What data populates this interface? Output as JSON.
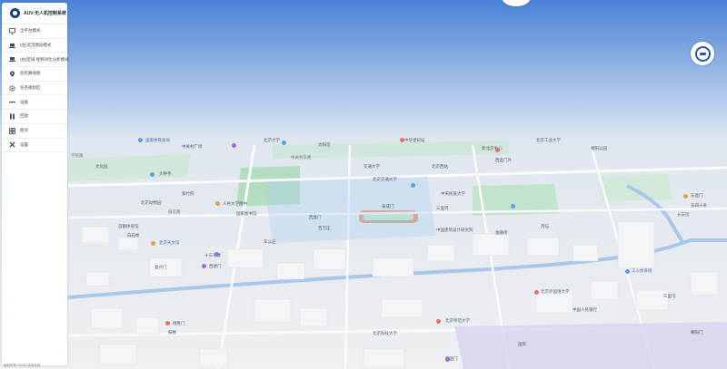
{
  "app": {
    "title": "AUV-无人机控制系统"
  },
  "menu": [
    {
      "icon": "monitor-icon",
      "label": "全平台模式"
    },
    {
      "icon": "laptop-icon",
      "label": "(左)灵活图层模式"
    },
    {
      "icon": "laptop-icon",
      "label": "(右)区域 视频对比分析模式"
    },
    {
      "icon": "location-pin-icon",
      "label": "巡检路线图"
    },
    {
      "icon": "gear-icon",
      "label": "任务规划区"
    },
    {
      "icon": "drone-icon",
      "label": "设备"
    },
    {
      "icon": "pause-icon",
      "label": "回放"
    },
    {
      "icon": "grid-icon",
      "label": "图文"
    },
    {
      "icon": "tools-icon",
      "label": "设置"
    }
  ],
  "footer": {
    "text": "版权所有 ©2023 技术支持"
  },
  "map": {
    "labels": [
      {
        "text": "国家体育总局",
        "color": "blue"
      },
      {
        "text": "中关村广场",
        "color": "gray"
      },
      {
        "text": "北京大学",
        "color": "gray"
      },
      {
        "text": "太阳宫",
        "color": "gray"
      },
      {
        "text": "中华世纪坛",
        "color": "gray"
      },
      {
        "text": "新北京中心",
        "color": "gray"
      },
      {
        "text": "北京工业大学",
        "color": "gray"
      },
      {
        "text": "朝阳公园",
        "color": "gray"
      },
      {
        "text": "学院路",
        "color": "road"
      },
      {
        "text": "文化园",
        "color": "gray"
      },
      {
        "text": "大钟寺",
        "color": "gray"
      },
      {
        "text": "中关村东路",
        "color": "road"
      },
      {
        "text": "交通大学",
        "color": "gray"
      },
      {
        "text": "北京西站",
        "color": "gray"
      },
      {
        "text": "西直门外",
        "color": "gray"
      },
      {
        "text": "北京交通大学",
        "color": "gray"
      },
      {
        "text": "中央民族大学",
        "color": "gray"
      },
      {
        "text": "紫竹院",
        "color": "gray"
      },
      {
        "text": "人民大学附中",
        "color": "gray"
      },
      {
        "text": "北京动物园",
        "color": "gray"
      },
      {
        "text": "西直门",
        "color": "gray"
      },
      {
        "text": "国家图书馆",
        "color": "gray"
      },
      {
        "text": "展览路",
        "color": "road"
      },
      {
        "text": "阜成门",
        "color": "gray"
      },
      {
        "text": "三里河",
        "color": "gray"
      },
      {
        "text": "首都体育馆",
        "color": "gray"
      },
      {
        "text": "白石桥",
        "color": "gray"
      },
      {
        "text": "车公庄",
        "color": "gray"
      },
      {
        "text": "百万庄",
        "color": "gray"
      },
      {
        "text": "中国建筑设计研究院",
        "color": "gray"
      },
      {
        "text": "北京天文馆",
        "color": "blue"
      },
      {
        "text": "金融街",
        "color": "gray"
      },
      {
        "text": "月坛",
        "color": "gray"
      },
      {
        "text": "十三号楼",
        "color": "gray"
      },
      {
        "text": "长安街",
        "color": "road"
      },
      {
        "text": "复兴门",
        "color": "gray"
      },
      {
        "text": "西便门",
        "color": "gray"
      },
      {
        "text": "北京外国语大学",
        "color": "gray"
      },
      {
        "text": "中国人民银行",
        "color": "gray"
      },
      {
        "text": "北京师范大学",
        "color": "gray"
      },
      {
        "text": "北京科技大学",
        "color": "gray"
      },
      {
        "text": "德胜门",
        "color": "gray"
      },
      {
        "text": "鼓楼",
        "color": "gray"
      },
      {
        "text": "东直门",
        "color": "gray"
      },
      {
        "text": "东四十条",
        "color": "gray"
      },
      {
        "text": "工人体育场",
        "color": "blue"
      },
      {
        "text": "三里屯",
        "color": "gray"
      },
      {
        "text": "朝阳门",
        "color": "gray"
      },
      {
        "text": "建国门",
        "color": "gray"
      },
      {
        "text": "国贸",
        "color": "gray"
      }
    ]
  }
}
